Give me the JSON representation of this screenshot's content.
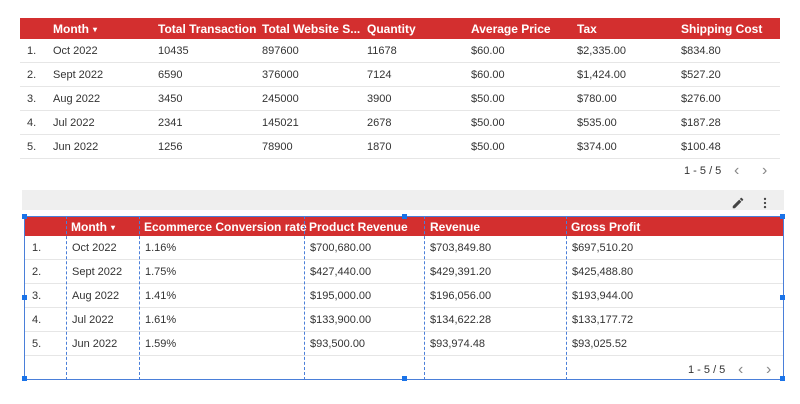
{
  "table1": {
    "headers": [
      "Month",
      "Total Transaction",
      "Total Website S...",
      "Quantity",
      "Average Price",
      "Tax",
      "Shipping Cost"
    ],
    "sort_indicator": "▾",
    "rows": [
      {
        "idx": "1.",
        "month": "Oct 2022",
        "tt": "10435",
        "tws": "897600",
        "qty": "11678",
        "avg": "$60.00",
        "tax": "$2,335.00",
        "ship": "$834.80"
      },
      {
        "idx": "2.",
        "month": "Sept 2022",
        "tt": "6590",
        "tws": "376000",
        "qty": "7124",
        "avg": "$60.00",
        "tax": "$1,424.00",
        "ship": "$527.20"
      },
      {
        "idx": "3.",
        "month": "Aug 2022",
        "tt": "3450",
        "tws": "245000",
        "qty": "3900",
        "avg": "$50.00",
        "tax": "$780.00",
        "ship": "$276.00"
      },
      {
        "idx": "4.",
        "month": "Jul 2022",
        "tt": "2341",
        "tws": "145021",
        "qty": "2678",
        "avg": "$50.00",
        "tax": "$535.00",
        "ship": "$187.28"
      },
      {
        "idx": "5.",
        "month": "Jun 2022",
        "tt": "1256",
        "tws": "78900",
        "qty": "1870",
        "avg": "$50.00",
        "tax": "$374.00",
        "ship": "$100.48"
      }
    ],
    "pagination": "1 - 5 / 5",
    "prev": "‹",
    "next": "›"
  },
  "table2": {
    "headers": [
      "Month",
      "Ecommerce Conversion rate",
      "Product Revenue",
      "Revenue",
      "Gross Profit"
    ],
    "sort_indicator": "▾",
    "rows": [
      {
        "idx": "1.",
        "month": "Oct 2022",
        "conv": "1.16%",
        "prod": "$700,680.00",
        "rev": "$703,849.80",
        "gp": "$697,510.20"
      },
      {
        "idx": "2.",
        "month": "Sept 2022",
        "conv": "1.75%",
        "prod": "$427,440.00",
        "rev": "$429,391.20",
        "gp": "$425,488.80"
      },
      {
        "idx": "3.",
        "month": "Aug 2022",
        "conv": "1.41%",
        "prod": "$195,000.00",
        "rev": "$196,056.00",
        "gp": "$193,944.00"
      },
      {
        "idx": "4.",
        "month": "Jul 2022",
        "conv": "1.61%",
        "prod": "$133,900.00",
        "rev": "$134,622.28",
        "gp": "$133,177.72"
      },
      {
        "idx": "5.",
        "month": "Jun 2022",
        "conv": "1.59%",
        "prod": "$93,500.00",
        "rev": "$93,974.48",
        "gp": "$93,025.52"
      }
    ],
    "pagination": "1 - 5 / 5",
    "prev": "‹",
    "next": "›"
  },
  "toolbar": {
    "edit_icon": "pencil-icon",
    "more_icon": "more-vert-icon"
  },
  "colors": {
    "header_bg": "#d32f2f",
    "selection": "#1a73e8",
    "band": "#efefef"
  }
}
